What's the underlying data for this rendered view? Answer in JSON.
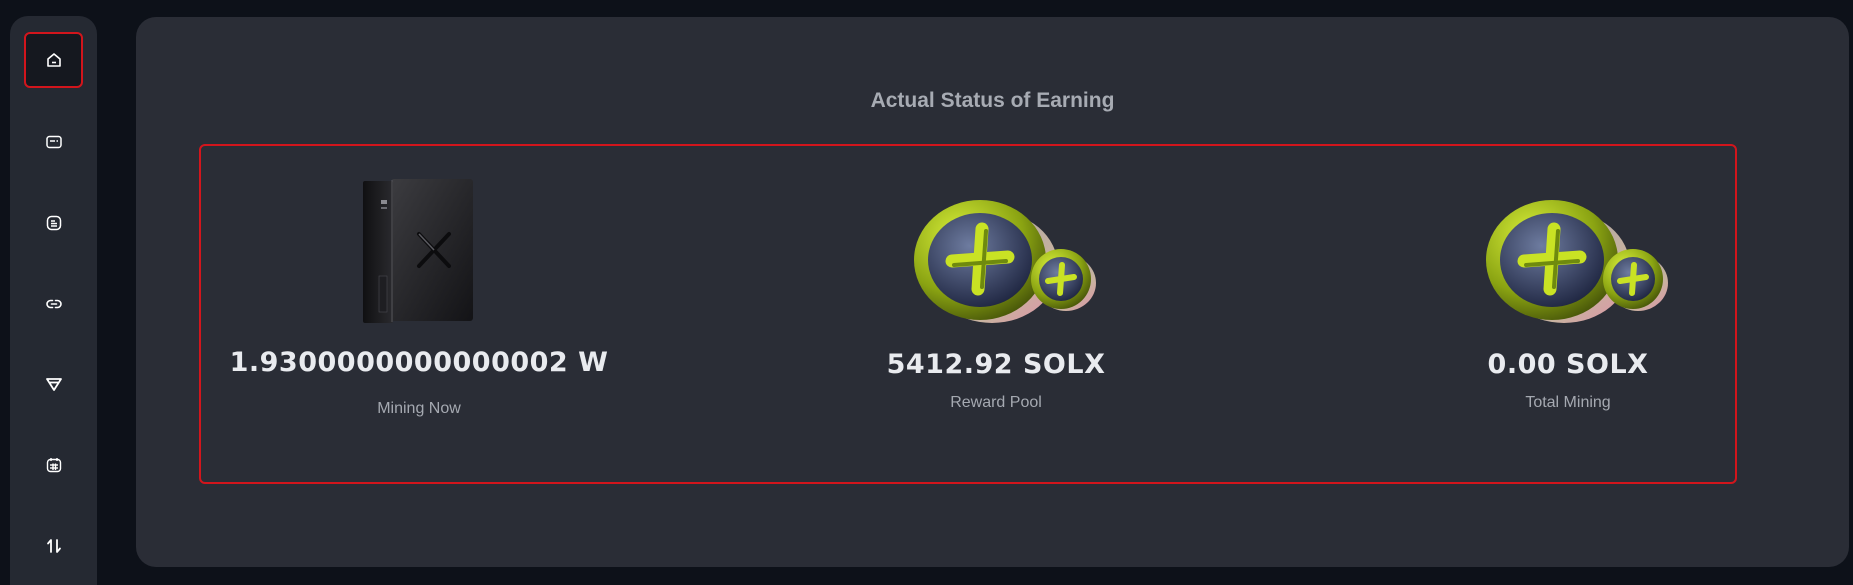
{
  "sidebar": {
    "items": [
      {
        "icon": "home-icon",
        "active": true
      },
      {
        "icon": "card-icon",
        "active": false
      },
      {
        "icon": "document-icon",
        "active": false
      },
      {
        "icon": "link-icon",
        "active": false
      },
      {
        "icon": "shield-icon",
        "active": false
      },
      {
        "icon": "calendar-icon",
        "active": false
      },
      {
        "icon": "swap-icon",
        "active": false
      }
    ]
  },
  "earnings": {
    "title": "Actual Status of Earning",
    "stats": [
      {
        "value": "1.9300000000000002 W",
        "label": "Mining Now",
        "image": "miner-device-image"
      },
      {
        "value": "5412.92 SOLX",
        "label": "Reward Pool",
        "image": "solx-coins-image"
      },
      {
        "value": "0.00 SOLX",
        "label": "Total Mining",
        "image": "solx-coins-image"
      }
    ]
  },
  "colors": {
    "accent": "#d2151c",
    "panel": "#2a2d36",
    "sidebar": "#252932",
    "background": "#0d1119",
    "coin_green": "#a8c414"
  }
}
